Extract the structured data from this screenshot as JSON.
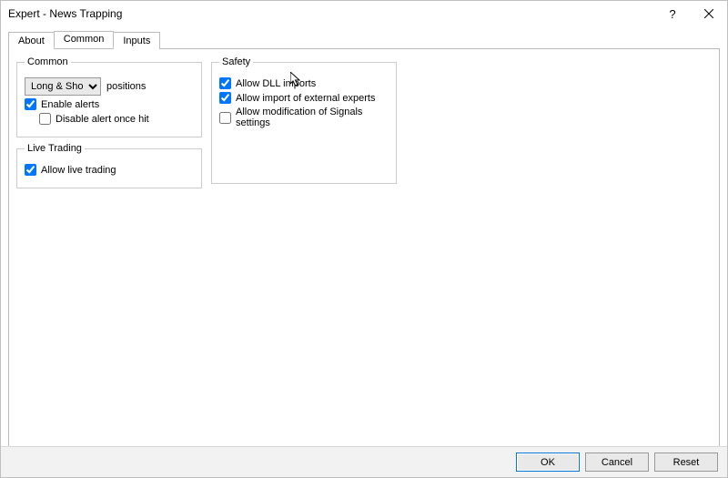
{
  "titlebar": {
    "text": "Expert - News Trapping"
  },
  "tabs": {
    "about": "About",
    "common": "Common",
    "inputs": "Inputs"
  },
  "common_group": {
    "legend": "Common",
    "positions_select": "Long & Short",
    "positions_label": "positions",
    "enable_alerts": "Enable alerts",
    "disable_alert_once": "Disable alert once hit"
  },
  "live_trading_group": {
    "legend": "Live Trading",
    "allow_live": "Allow live trading"
  },
  "safety_group": {
    "legend": "Safety",
    "allow_dll": "Allow DLL imports",
    "allow_ext_experts": "Allow import of external experts",
    "allow_signals_mod": "Allow modification of Signals settings"
  },
  "buttons": {
    "ok": "OK",
    "cancel": "Cancel",
    "reset": "Reset"
  },
  "state": {
    "enable_alerts": true,
    "disable_alert_once": false,
    "allow_live": true,
    "allow_dll": true,
    "allow_ext_experts": true,
    "allow_signals_mod": false
  }
}
